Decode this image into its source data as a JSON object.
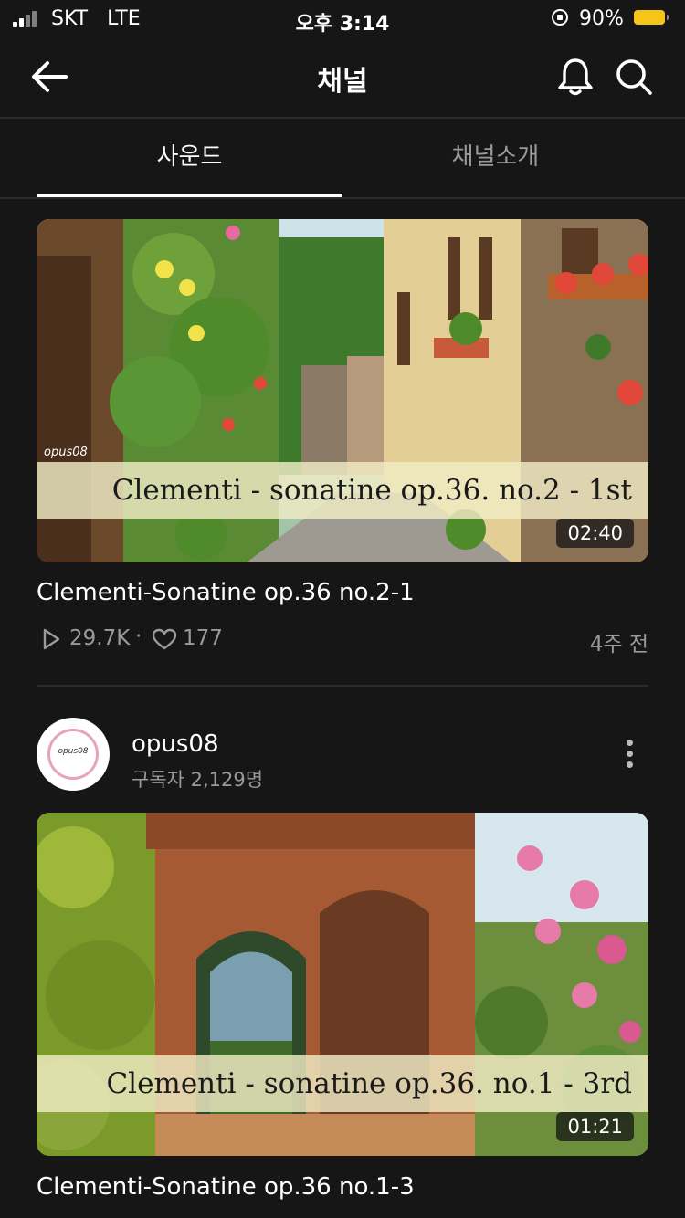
{
  "status_bar": {
    "carrier": "SKT   LTE",
    "time": "오후 3:14",
    "battery": "90%"
  },
  "header": {
    "title": "채널"
  },
  "tabs": [
    {
      "label": "사운드",
      "active": true
    },
    {
      "label": "채널소개",
      "active": false
    }
  ],
  "videos": [
    {
      "thumb_caption": "Clementi - sonatine op.36. no.2 - 1st",
      "watermark": "opus08",
      "duration": "02:40",
      "title": "Clementi-Sonatine op.36 no.2-1",
      "plays": "29.7K",
      "separator": "·",
      "likes": "177",
      "ago": "4주 전"
    },
    {
      "thumb_caption": "Clementi - sonatine op.36. no.1 - 3rd",
      "duration": "01:21",
      "title": "Clementi-Sonatine op.36 no.1-3"
    }
  ],
  "channel": {
    "avatar_text": "opus08",
    "name": "opus08",
    "subscribers": "구독자 2,129명"
  },
  "colors": {
    "background": "#161616",
    "battery": "#f5c518",
    "caption_band": "#f0ecc4",
    "avatar_ring": "#e7a3bb"
  },
  "icons": [
    "back-arrow-icon",
    "bell-icon",
    "search-icon",
    "play-icon",
    "heart-icon",
    "more-vertical-icon"
  ]
}
